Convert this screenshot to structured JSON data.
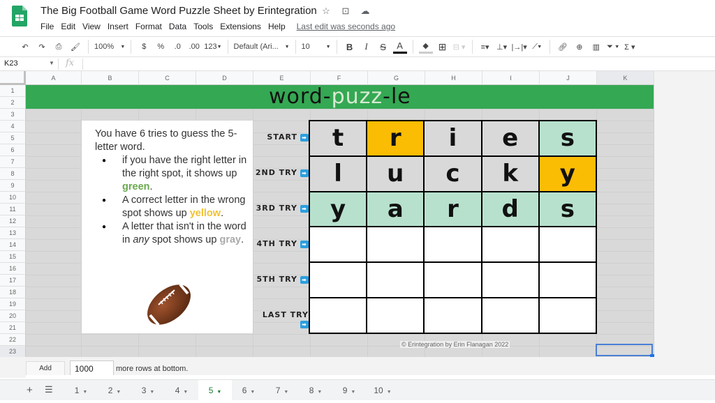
{
  "app": {
    "title": "The Big Football Game Word Puzzle Sheet by Erintegration",
    "title_icons": [
      "star-icon",
      "move-to-folder-icon",
      "cloud-status-icon"
    ],
    "menu": [
      "File",
      "Edit",
      "View",
      "Insert",
      "Format",
      "Data",
      "Tools",
      "Extensions",
      "Help"
    ],
    "last_edit": "Last edit was seconds ago"
  },
  "toolbar": {
    "zoom": "100%",
    "currency": "$",
    "percent": "%",
    "decrease_decimals": ".0",
    "increase_decimals": ".00",
    "more_formats": "123",
    "font": "Default (Ari...",
    "font_size": "10",
    "bold": "B",
    "italic": "I",
    "strikethrough": "S",
    "text_color": "A"
  },
  "formula_bar": {
    "cell_ref": "K23",
    "fx": "fx",
    "value": ""
  },
  "columns": [
    "A",
    "B",
    "C",
    "D",
    "E",
    "F",
    "G",
    "H",
    "I",
    "J",
    "K"
  ],
  "rows": [
    "1",
    "2",
    "3",
    "4",
    "5",
    "6",
    "7",
    "8",
    "9",
    "10",
    "11",
    "12",
    "13",
    "14",
    "15",
    "16",
    "17",
    "18",
    "19",
    "20",
    "21",
    "22",
    "23"
  ],
  "banner": {
    "part1": "word-",
    "part2": "puzz",
    "part3": "-le",
    "background": "#34a853"
  },
  "instructions": {
    "intro": "You have 6 tries to guess the 5-letter word.",
    "bullet1_pre": "if you have the right letter in the right spot, it shows up ",
    "bullet1_color": "green",
    "bullet1_post": ".",
    "bullet2_pre": "A correct letter in the wrong spot shows up ",
    "bullet2_color": "yellow",
    "bullet2_post": ".",
    "bullet3_pre": "A letter that isn't in the word in ",
    "bullet3_em": "any",
    "bullet3_mid": " spot shows up ",
    "bullet3_color": "gray",
    "bullet3_post": "."
  },
  "colors": {
    "green": "#b7e1cd",
    "yellow": "#fbbc04",
    "gray": "#d9d9d9",
    "empty": "#ffffff"
  },
  "tries": [
    {
      "label": "start",
      "letters": [
        "t",
        "r",
        "i",
        "e",
        "s"
      ],
      "states": [
        "gray",
        "yellow",
        "gray",
        "gray",
        "green"
      ]
    },
    {
      "label": "2nd try",
      "letters": [
        "l",
        "u",
        "c",
        "k",
        "y"
      ],
      "states": [
        "gray",
        "gray",
        "gray",
        "gray",
        "yellow"
      ]
    },
    {
      "label": "3rd try",
      "letters": [
        "y",
        "a",
        "r",
        "d",
        "s"
      ],
      "states": [
        "green",
        "green",
        "green",
        "green",
        "green"
      ]
    },
    {
      "label": "4th try",
      "letters": [
        "",
        "",
        "",
        "",
        ""
      ],
      "states": [
        "empty",
        "empty",
        "empty",
        "empty",
        "empty"
      ]
    },
    {
      "label": "5th try",
      "letters": [
        "",
        "",
        "",
        "",
        ""
      ],
      "states": [
        "empty",
        "empty",
        "empty",
        "empty",
        "empty"
      ]
    },
    {
      "label": "last try",
      "letters": [
        "",
        "",
        "",
        "",
        ""
      ],
      "states": [
        "empty",
        "empty",
        "empty",
        "empty",
        "empty"
      ]
    }
  ],
  "copyright": "© Erintegration by Erin Flanagan 2022",
  "add_rows": {
    "button": "Add",
    "count": "1000",
    "suffix": "more rows at bottom."
  },
  "sheet_tabs": {
    "items": [
      "1",
      "2",
      "3",
      "4",
      "5",
      "6",
      "7",
      "8",
      "9",
      "10"
    ],
    "active": "5"
  }
}
